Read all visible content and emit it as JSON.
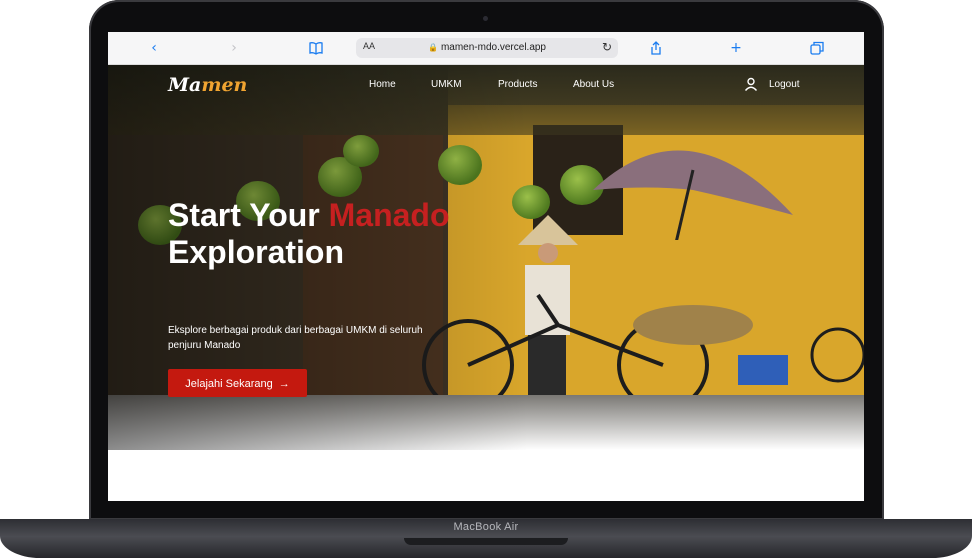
{
  "device": {
    "label": "MacBook Air"
  },
  "browser": {
    "text_size_label": "AA",
    "url": "mamen-mdo.vercel.app",
    "icons": [
      "back-icon",
      "forward-icon",
      "bookmarks-icon",
      "lock-icon",
      "reload-icon",
      "share-icon",
      "new-tab-icon",
      "tabs-icon"
    ]
  },
  "site": {
    "logo": {
      "part1": "Ma",
      "part2": "men"
    },
    "nav": [
      "Home",
      "UMKM",
      "Products",
      "About Us"
    ],
    "logout_label": "Logout",
    "hero": {
      "title_part1": "Start Your ",
      "title_highlight": "Manado",
      "title_part2": "Exploration",
      "description": "Eksplore berbagai produk dari berbagai UMKM di seluruh penjuru Manado",
      "cta_label": "Jelajahi Sekarang"
    }
  },
  "colors": {
    "accent_red": "#c4190f",
    "highlight_red": "#c62020",
    "logo_orange": "#f0a431",
    "safari_blue": "#1a7cf0"
  }
}
